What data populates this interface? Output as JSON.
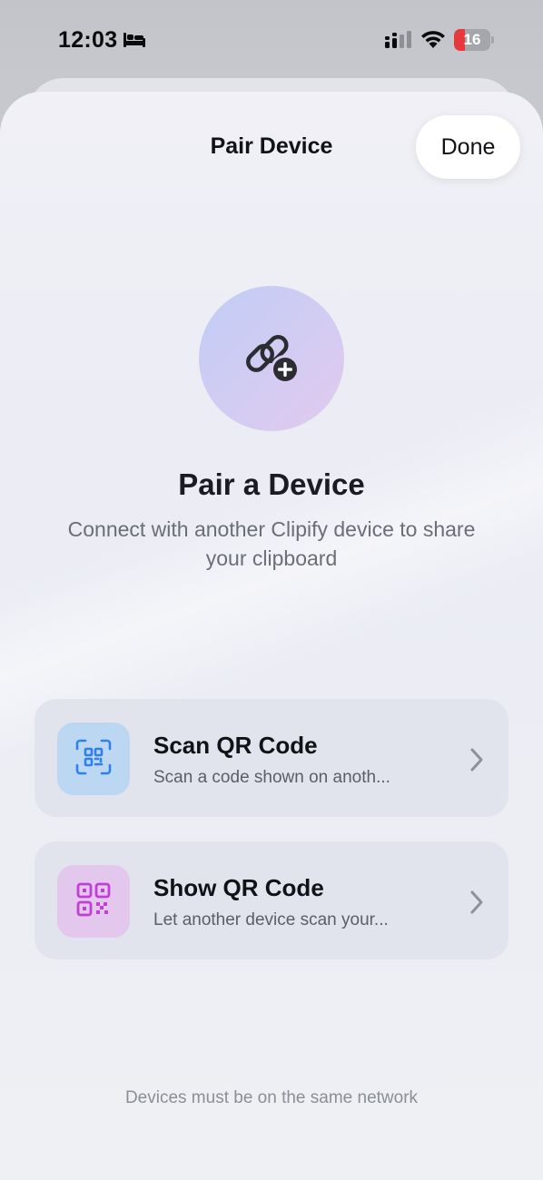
{
  "status_bar": {
    "time": "12:03",
    "battery_level": "16",
    "battery_fraction": 0.16,
    "icons": [
      "bed-icon",
      "cellular-signal-icon",
      "wifi-icon",
      "battery-icon"
    ]
  },
  "nav": {
    "title": "Pair Device",
    "done_label": "Done"
  },
  "hero": {
    "icon": "link-add-icon",
    "title": "Pair a Device",
    "subtitle": "Connect with another Clipify device to share your clipboard"
  },
  "options": [
    {
      "title": "Scan QR Code",
      "subtitle": "Scan a code shown on anoth...",
      "icon": "qr-scan-icon",
      "accent": "#2f80ed"
    },
    {
      "title": "Show QR Code",
      "subtitle": "Let another device scan your...",
      "icon": "qr-code-icon",
      "accent": "#c13fd6"
    }
  ],
  "footer": {
    "note": "Devices must be on the same network"
  },
  "colors": {
    "battery_low": "#e5393c",
    "text_primary": "#111216",
    "text_secondary": "#6b6e77"
  }
}
